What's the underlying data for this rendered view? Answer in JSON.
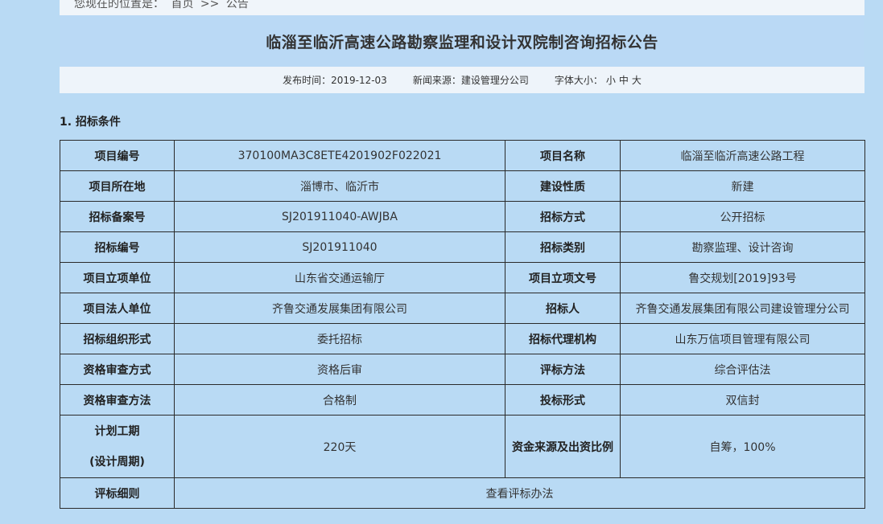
{
  "breadcrumb": {
    "prefix": "您现在的位置是：",
    "home": "首页",
    "sep": ">>",
    "current": "公告"
  },
  "page_title": "临淄至临沂高速公路勘察监理和设计双院制咨询招标公告",
  "meta": {
    "publish_label": "发布时间：",
    "publish_date": "2019-12-03",
    "source_label": "新闻来源：",
    "source": "建设管理分公司",
    "font_label": "字体大小：",
    "font_small": "小",
    "font_medium": "中",
    "font_large": "大"
  },
  "section1": "1. 招标条件",
  "table": {
    "rows": [
      {
        "l1": "项目编号",
        "v1": "370100MA3C8ETE4201902F022021",
        "l2": "项目名称",
        "v2": "临淄至临沂高速公路工程"
      },
      {
        "l1": "项目所在地",
        "v1": "淄博市、临沂市",
        "l2": "建设性质",
        "v2": "新建"
      },
      {
        "l1": "招标备案号",
        "v1": "SJ201911040-AWJBA",
        "l2": "招标方式",
        "v2": "公开招标"
      },
      {
        "l1": "招标编号",
        "v1": "SJ201911040",
        "l2": "招标类别",
        "v2": "勘察监理、设计咨询"
      },
      {
        "l1": "项目立项单位",
        "v1": "山东省交通运输厅",
        "l2": "项目立项文号",
        "v2": "鲁交规划[2019]93号"
      },
      {
        "l1": "项目法人单位",
        "v1": "齐鲁交通发展集团有限公司",
        "l2": "招标人",
        "v2": "齐鲁交通发展集团有限公司建设管理分公司"
      },
      {
        "l1": "招标组织形式",
        "v1": "委托招标",
        "l2": "招标代理机构",
        "v2": "山东万信项目管理有限公司"
      },
      {
        "l1": "资格审查方式",
        "v1": "资格后审",
        "l2": "评标方法",
        "v2": "综合评估法"
      },
      {
        "l1": "资格审查方法",
        "v1": "合格制",
        "l2": "投标形式",
        "v2": "双信封"
      }
    ],
    "period": {
      "label_line1": "计划工期",
      "label_line2": "(设计周期)",
      "value": "220天",
      "funding_label": "资金来源及出资比例",
      "funding_value": "自筹，100%"
    },
    "rules": {
      "label": "评标细则",
      "link": "查看评标办法"
    }
  }
}
